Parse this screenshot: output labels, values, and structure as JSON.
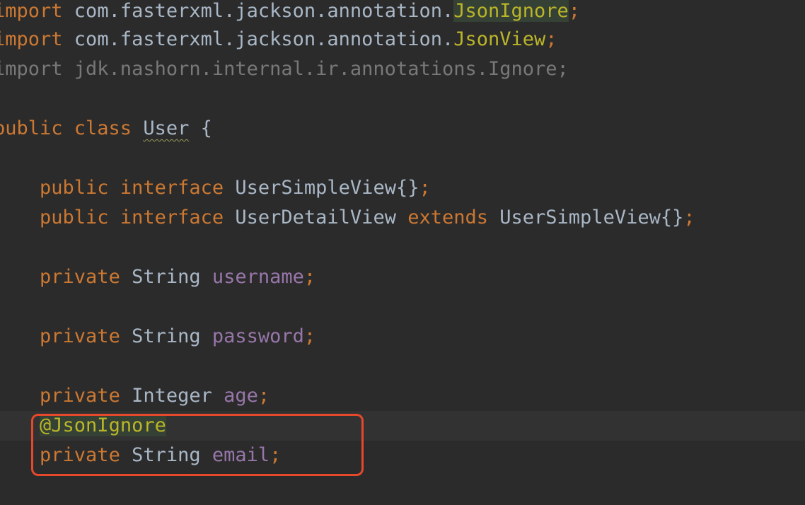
{
  "code": {
    "import1": {
      "kw": "import",
      "pkg": " com.fasterxml.jackson.annotation.",
      "cls": "JsonIgnore",
      "semi": ";"
    },
    "import2": {
      "kw": "import",
      "pkg": " com.fasterxml.jackson.annotation.",
      "cls": "JsonView",
      "semi": ";"
    },
    "import3": {
      "text": "import jdk.nashorn.internal.ir.annotations.Ignore;"
    },
    "class_decl": {
      "kw": "public class ",
      "name": "User",
      "brace": " {"
    },
    "iface1": {
      "indent": "    ",
      "kw": "public interface ",
      "name": "UserSimpleView{}",
      "semi": ";"
    },
    "iface2": {
      "indent": "    ",
      "kw": "public interface ",
      "name": "UserDetailView ",
      "kw2": "extends ",
      "name2": "UserSimpleView{}",
      "semi": ";"
    },
    "field_username": {
      "indent": "    ",
      "kw": "private ",
      "type": "String ",
      "name": "username",
      "semi": ";"
    },
    "field_password": {
      "indent": "    ",
      "kw": "private ",
      "type": "String ",
      "name": "password",
      "semi": ";"
    },
    "field_age": {
      "indent": "    ",
      "kw": "private ",
      "type": "Integer ",
      "name": "age",
      "semi": ";"
    },
    "annotation": {
      "indent": "    ",
      "text": "@JsonIgnore"
    },
    "field_email": {
      "indent": "    ",
      "kw": "private ",
      "type": "String ",
      "name": "email",
      "semi": ";"
    }
  },
  "colors": {
    "background": "#2b2b2b",
    "keyword": "#cc7832",
    "annotation": "#bbb529",
    "field": "#9876aa",
    "text": "#a9b7c6",
    "highlight_box": "#e5482a"
  }
}
